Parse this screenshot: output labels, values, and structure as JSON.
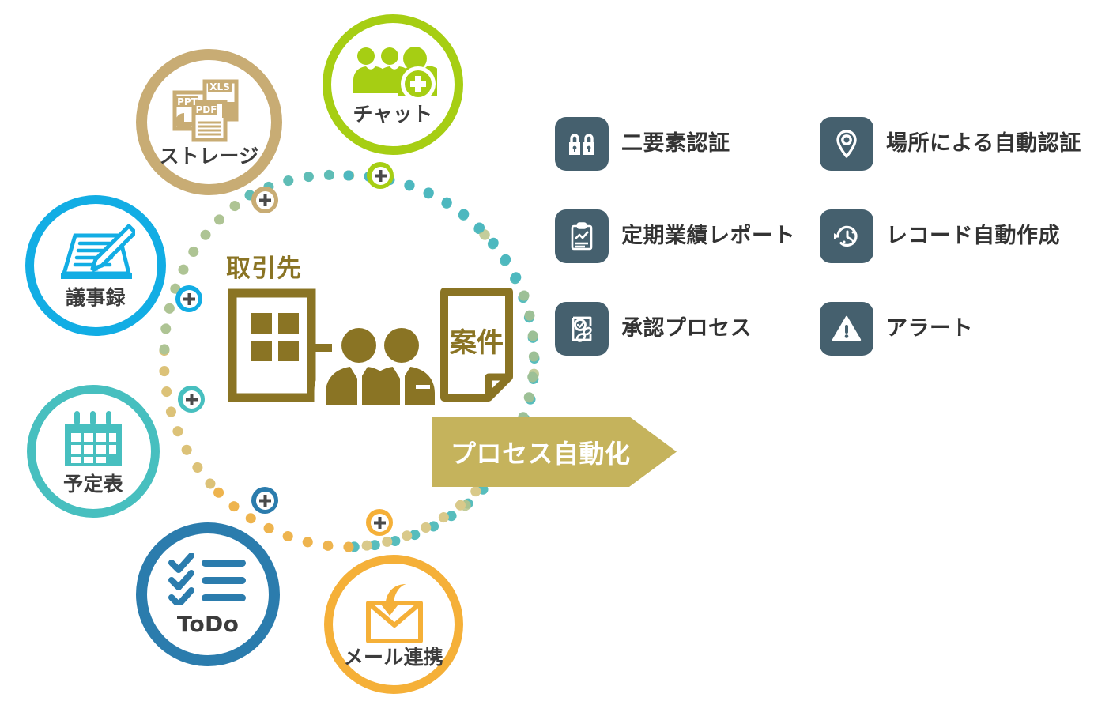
{
  "diagram": {
    "center": {
      "title": "取引先",
      "doc_label": "案件"
    },
    "process_arrow": {
      "label": "プロセス自動化",
      "color": "#c5b35c"
    },
    "bubbles": [
      {
        "key": "storage",
        "label": "ストレージ",
        "icon": "documents-icon",
        "color": "#c8ac74",
        "files": [
          "PPT",
          "XLS",
          "PDF"
        ]
      },
      {
        "key": "chat",
        "label": "チャット",
        "icon": "group-add-icon",
        "color": "#a6ce13"
      },
      {
        "key": "minutes",
        "label": "議事録",
        "icon": "notebook-pen-icon",
        "color": "#12ade4"
      },
      {
        "key": "schedule",
        "label": "予定表",
        "icon": "calendar-icon",
        "color": "#47bfbf"
      },
      {
        "key": "todo",
        "label": "ToDo",
        "icon": "checklist-icon",
        "color": "#2b7cad"
      },
      {
        "key": "mail",
        "label": "メール連携",
        "icon": "mail-arrow-icon",
        "color": "#f5b038"
      }
    ],
    "nodes": [
      {
        "key": "node-chat",
        "color": "#a6ce13"
      },
      {
        "key": "node-storage",
        "color": "#c8ac74"
      },
      {
        "key": "node-minutes",
        "color": "#12ade4"
      },
      {
        "key": "node-schedule",
        "color": "#47bfbf"
      },
      {
        "key": "node-todo",
        "color": "#2b7cad"
      },
      {
        "key": "node-mail",
        "color": "#f5b038"
      }
    ],
    "features": [
      {
        "key": "two-factor",
        "label": "二要素認証",
        "icon": "double-lock-icon"
      },
      {
        "key": "location-auth",
        "label": "場所による自動認証",
        "icon": "map-pin-icon"
      },
      {
        "key": "periodic-report",
        "label": "定期業績レポート",
        "icon": "clipboard-chart-icon"
      },
      {
        "key": "record-auto",
        "label": "レコード自動作成",
        "icon": "clock-rewind-icon"
      },
      {
        "key": "approval",
        "label": "承認プロセス",
        "icon": "approval-stamp-icon"
      },
      {
        "key": "alert",
        "label": "アラート",
        "icon": "warning-triangle-icon"
      }
    ],
    "colors": {
      "feature_icon_bg": "#45606e",
      "center_gold": "#8a7424",
      "text_dark": "#333333"
    }
  }
}
